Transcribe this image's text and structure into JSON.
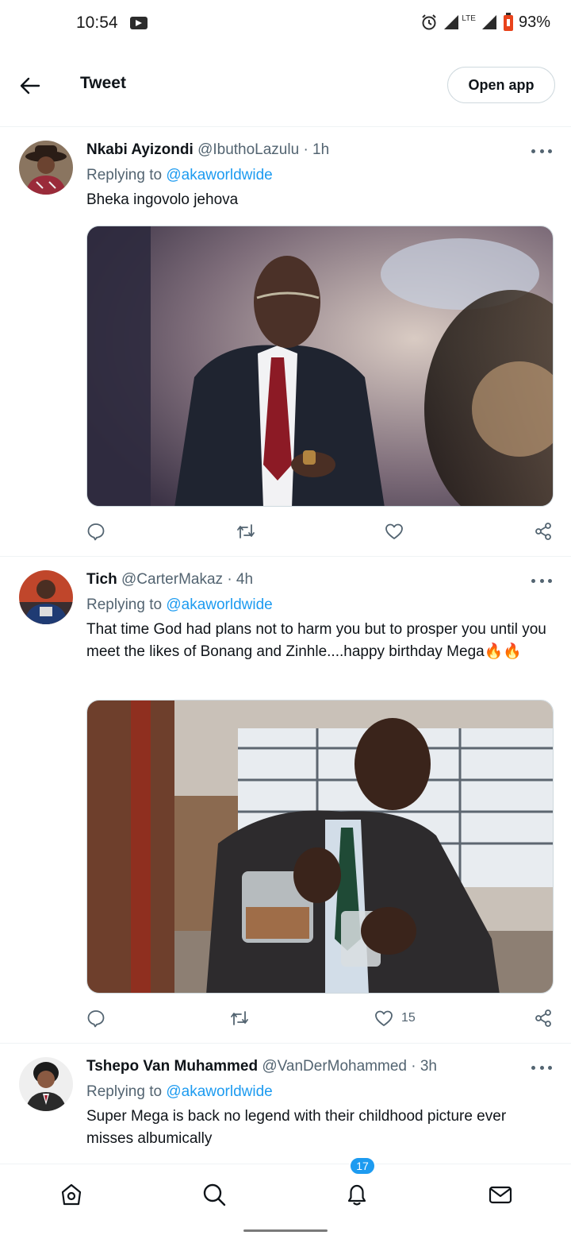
{
  "status_bar": {
    "time": "10:54",
    "network": "LTE",
    "battery": "93%"
  },
  "header": {
    "title": "Tweet",
    "open_app": "Open app"
  },
  "tweets": [
    {
      "name": "Nkabi Ayizondi",
      "meta": "@IbuthoLazulu · 1h",
      "reply_prefix": "Replying to ",
      "reply_handle": "@akaworldwide",
      "text": "Bheka ingovolo jehova",
      "like_count": ""
    },
    {
      "name": "Tich",
      "meta": "@CarterMakaz · 4h",
      "reply_prefix": "Replying to ",
      "reply_handle": "@akaworldwide",
      "text": "That time God had plans not to harm you but to prosper you until you meet the likes of Bonang and Zinhle....happy birthday Mega🔥🔥",
      "like_count": "15"
    },
    {
      "name": "Tshepo Van Muhammed",
      "meta": "@VanDerMohammed · 3h",
      "reply_prefix": "Replying to ",
      "reply_handle": "@akaworldwide",
      "text": "Super Mega is back no legend with their childhood picture ever misses albumically",
      "like_count": ""
    }
  ],
  "bottom_nav": {
    "notifications_badge": "17",
    "items": [
      "home-icon",
      "search-icon",
      "bell-icon",
      "mail-icon"
    ]
  },
  "colors": {
    "accent": "#1d9bf0",
    "secondary_text": "#536471",
    "primary_text": "#0f1419"
  }
}
